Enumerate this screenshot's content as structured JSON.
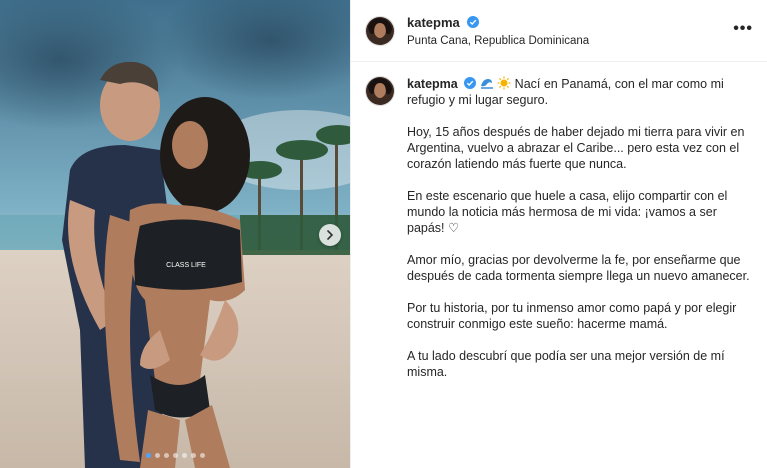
{
  "post": {
    "username": "katepma",
    "location": "Punta Cana, Republica Dominicana",
    "more_icon": "ellipsis-icon",
    "carousel": {
      "total": 7,
      "active": 0
    },
    "caption": {
      "username": "katepma",
      "emojis": [
        "wave-emoji",
        "sun-emoji"
      ],
      "first_line": "Nací en Panamá, con el mar como mi refugio y mi lugar seguro.",
      "paragraphs": [
        "Hoy, 15 años después de haber dejado mi tierra para vivir en Argentina, vuelvo a abrazar el Caribe... pero esta vez con el corazón latiendo más fuerte que nunca.",
        "En este escenario que huele a casa, elijo compartir con el mundo la noticia más hermosa de mi vida: ¡vamos a ser papás! ♡",
        "Amor mío, gracias por devolverme la fe, por enseñarme que después de cada tormenta siempre llega un nuevo amanecer.",
        "Por tu historia, por tu inmenso amor como papá y por elegir construir conmigo este sueño: hacerme mamá.",
        "A tu lado descubrí que podía ser una mejor versión de mí misma."
      ]
    },
    "photo_logo_text": "CLASS LIFE"
  }
}
